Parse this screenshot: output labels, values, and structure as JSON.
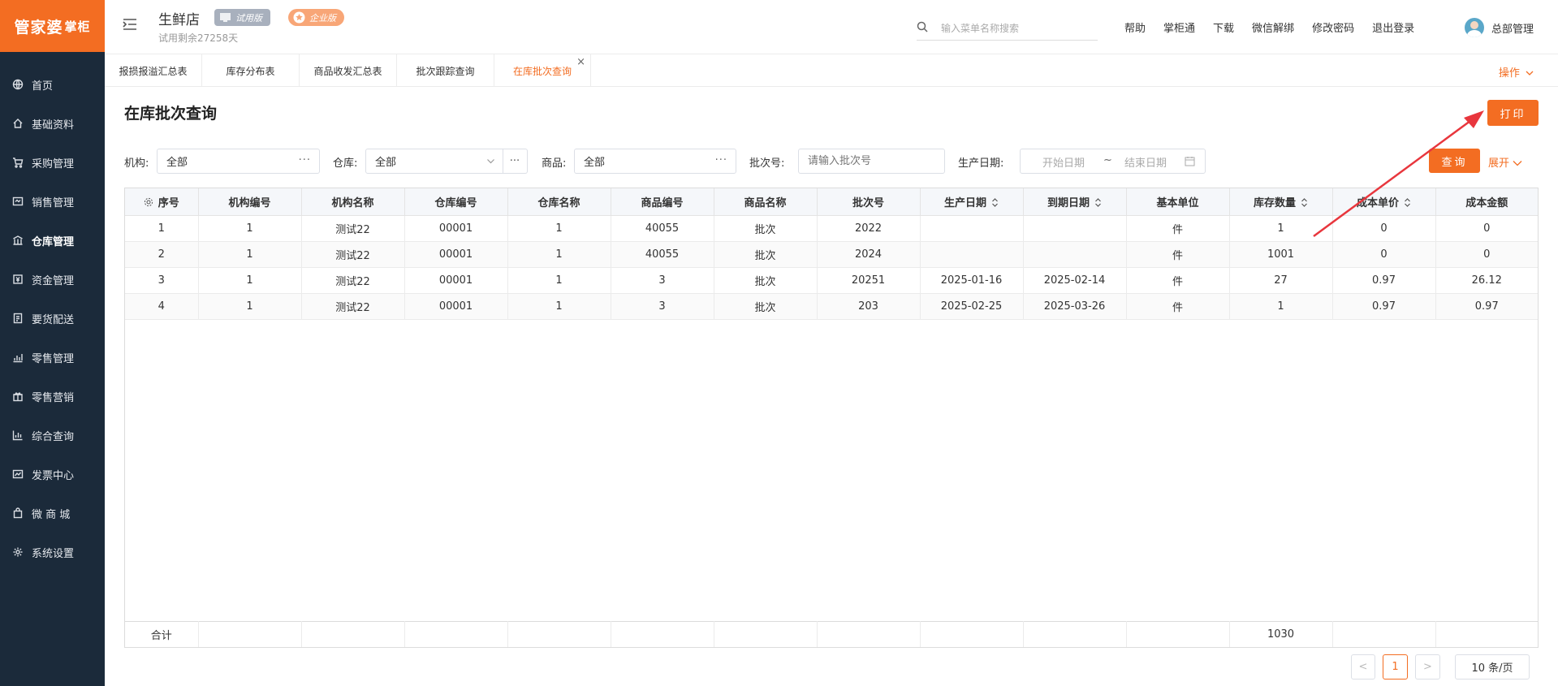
{
  "sidebar": {
    "logo_main": "管家婆",
    "logo_sub": "掌柜",
    "items": [
      {
        "label": "首页",
        "icon": "globe-icon"
      },
      {
        "label": "基础资料",
        "icon": "home-icon"
      },
      {
        "label": "采购管理",
        "icon": "cart-icon"
      },
      {
        "label": "销售管理",
        "icon": "sales-icon"
      },
      {
        "label": "仓库管理",
        "icon": "warehouse-icon"
      },
      {
        "label": "资金管理",
        "icon": "money-icon"
      },
      {
        "label": "要货配送",
        "icon": "delivery-icon"
      },
      {
        "label": "零售管理",
        "icon": "chart-icon"
      },
      {
        "label": "零售营销",
        "icon": "gift-icon"
      },
      {
        "label": "综合查询",
        "icon": "bar-chart-icon"
      },
      {
        "label": "发票中心",
        "icon": "invoice-icon"
      },
      {
        "label": "微 商 城",
        "icon": "bag-icon"
      },
      {
        "label": "系统设置",
        "icon": "gear-icon"
      }
    ]
  },
  "header": {
    "shop_name": "生鲜店",
    "badge_trial": "试用版",
    "badge_enterprise": "企业版",
    "trial_days": "试用剩余27258天",
    "search_placeholder": "输入菜单名称搜索",
    "links": [
      "帮助",
      "掌柜通",
      "下载",
      "微信解绑",
      "修改密码",
      "退出登录"
    ],
    "user_name": "总部管理"
  },
  "tabs": [
    {
      "label": "报损报溢汇总表",
      "active": false
    },
    {
      "label": "库存分布表",
      "active": false
    },
    {
      "label": "商品收发汇总表",
      "active": false
    },
    {
      "label": "批次跟踪查询",
      "active": false
    },
    {
      "label": "在库批次查询",
      "active": true
    }
  ],
  "tabs_close": "×",
  "operations_label": "操作",
  "page": {
    "title": "在库批次查询",
    "print_label": "打印",
    "query_label": "查询",
    "expand_label": "展开"
  },
  "filters": {
    "org_label": "机构:",
    "org_value": "全部",
    "warehouse_label": "仓库:",
    "warehouse_value": "全部",
    "product_label": "商品:",
    "product_value": "全部",
    "batch_label": "批次号:",
    "batch_placeholder": "请输入批次号",
    "date_label": "生产日期:",
    "date_start_placeholder": "开始日期",
    "date_sep": "~",
    "date_end_placeholder": "结束日期",
    "more": "···"
  },
  "table": {
    "columns": [
      "序号",
      "机构编号",
      "机构名称",
      "仓库编号",
      "仓库名称",
      "商品编号",
      "商品名称",
      "批次号",
      "生产日期",
      "到期日期",
      "基本单位",
      "库存数量",
      "成本单价",
      "成本金额"
    ],
    "rows": [
      [
        "1",
        "1",
        "测试22",
        "00001",
        "1",
        "40055",
        "批次",
        "2022",
        "",
        "",
        "件",
        "1",
        "0",
        "0"
      ],
      [
        "2",
        "1",
        "测试22",
        "00001",
        "1",
        "40055",
        "批次",
        "2024",
        "",
        "",
        "件",
        "1001",
        "0",
        "0"
      ],
      [
        "3",
        "1",
        "测试22",
        "00001",
        "1",
        "3",
        "批次",
        "20251",
        "2025-01-16",
        "2025-02-14",
        "件",
        "27",
        "0.97",
        "26.12"
      ],
      [
        "4",
        "1",
        "测试22",
        "00001",
        "1",
        "3",
        "批次",
        "203",
        "2025-02-25",
        "2025-03-26",
        "件",
        "1",
        "0.97",
        "0.97"
      ]
    ],
    "summary_label": "合计",
    "summary_stock": "1030"
  },
  "pagination": {
    "prev": "<",
    "current": "1",
    "next": ">",
    "page_size": "10 条/页"
  },
  "colors": {
    "accent": "#f36d22",
    "sidebar_bg": "#1b2a3a",
    "arrow": "#e8363d"
  }
}
